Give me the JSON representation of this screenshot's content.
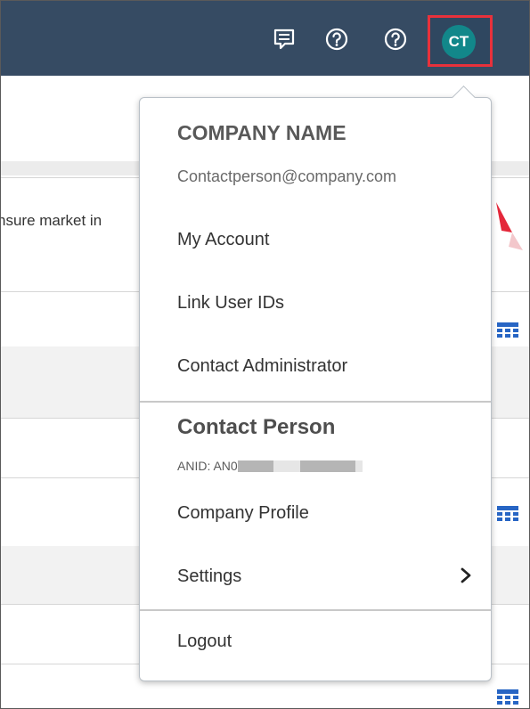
{
  "header": {
    "icons": [
      "notifications-icon",
      "help-icon",
      "help-icon"
    ],
    "avatar_initials": "CT",
    "colors": {
      "bar": "#364b63",
      "avatar": "#12878a",
      "highlight": "#e8313b"
    }
  },
  "background": {
    "visible_text": "nsure market in",
    "icons": [
      "calendar-grid-icon"
    ]
  },
  "menu": {
    "company_name": "COMPANY NAME",
    "email": "Contactperson@company.com",
    "items": [
      {
        "label": "My Account"
      },
      {
        "label": "Link User IDs"
      },
      {
        "label": "Contact Administrator"
      }
    ],
    "user": {
      "name": "Contact Person",
      "anid_label": "ANID: AN0"
    },
    "user_items": [
      {
        "label": "Company Profile"
      },
      {
        "label": "Settings"
      }
    ],
    "logout_label": "Logout"
  }
}
